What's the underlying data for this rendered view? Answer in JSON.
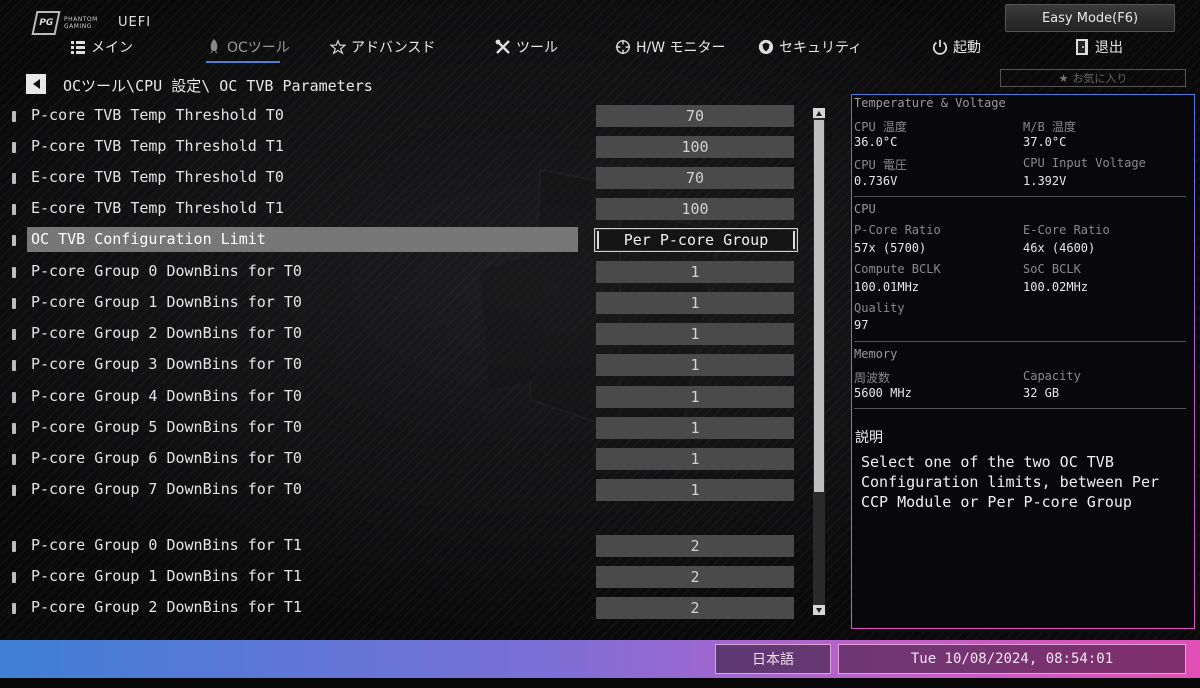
{
  "header": {
    "logo_text_1": "PHANTOM",
    "logo_text_2": "GAMING",
    "uefi": "UEFI",
    "easy_mode": "Easy Mode(F6)",
    "favorites": "お気に入り"
  },
  "nav": [
    {
      "label": "メイン",
      "icon": "list-icon"
    },
    {
      "label": "OCツール",
      "icon": "rocket-icon"
    },
    {
      "label": "アドバンスド",
      "icon": "star-icon"
    },
    {
      "label": "ツール",
      "icon": "tools-icon"
    },
    {
      "label": "H/W モニター",
      "icon": "crosshair-icon"
    },
    {
      "label": "セキュリティ",
      "icon": "shield-icon"
    },
    {
      "label": "起動",
      "icon": "power-icon"
    },
    {
      "label": "退出",
      "icon": "exit-icon"
    }
  ],
  "breadcrumb": "OCツール\\CPU 設定\\  OC TVB Parameters",
  "settings": [
    {
      "label": "P-core TVB Temp Threshold T0",
      "value": "70"
    },
    {
      "label": "P-core TVB Temp Threshold T1",
      "value": "100"
    },
    {
      "label": "E-core TVB Temp Threshold T0",
      "value": "70"
    },
    {
      "label": "E-core TVB Temp Threshold T1",
      "value": "100"
    },
    {
      "label": "OC TVB Configuration Limit",
      "value": "Per P-core Group"
    },
    {
      "label": "P-core Group 0 DownBins for T0",
      "value": "1"
    },
    {
      "label": "P-core Group 1 DownBins for T0",
      "value": "1"
    },
    {
      "label": "P-core Group 2 DownBins for T0",
      "value": "1"
    },
    {
      "label": "P-core Group 3 DownBins for T0",
      "value": "1"
    },
    {
      "label": "P-core Group 4 DownBins for T0",
      "value": "1"
    },
    {
      "label": "P-core Group 5 DownBins for T0",
      "value": "1"
    },
    {
      "label": "P-core Group 6 DownBins for T0",
      "value": "1"
    },
    {
      "label": "P-core Group 7 DownBins for T0",
      "value": "1"
    },
    {
      "label": "P-core Group 0 DownBins for T1",
      "value": "2"
    },
    {
      "label": "P-core Group 1 DownBins for T1",
      "value": "2"
    },
    {
      "label": "P-core Group 2 DownBins for T1",
      "value": "2"
    }
  ],
  "monitor": {
    "temp_voltage_title": "Temperature & Voltage",
    "cpu_temp_label": "CPU 温度",
    "cpu_temp": "36.0°C",
    "mb_temp_label": "M/B 温度",
    "mb_temp": "37.0°C",
    "cpu_volt_label": "CPU 電圧",
    "cpu_volt": "0.736V",
    "cpu_input_label": "CPU Input Voltage",
    "cpu_input": "1.392V",
    "cpu_title": "CPU",
    "pcore_ratio_label": "P-Core Ratio",
    "pcore_ratio": "57x (5700)",
    "ecore_ratio_label": "E-Core Ratio",
    "ecore_ratio": "46x (4600)",
    "compute_bclk_label": "Compute BCLK",
    "compute_bclk": "100.01MHz",
    "soc_bclk_label": "SoC BCLK",
    "soc_bclk": "100.02MHz",
    "quality_label": "Quality",
    "quality": "97",
    "memory_title": "Memory",
    "freq_label": "周波数",
    "freq": "5600 MHz",
    "capacity_label": "Capacity",
    "capacity": "32 GB"
  },
  "description": {
    "title": "説明",
    "body": "Select one of the two OC TVB Configuration limits, between Per CCP Module or Per P-core Group"
  },
  "footer": {
    "language": "日本語",
    "datetime": "Tue 10/08/2024, 08:54:01"
  },
  "colors": {
    "accent_blue": "#4e7fd6",
    "accent_pink": "#e04fb6"
  }
}
